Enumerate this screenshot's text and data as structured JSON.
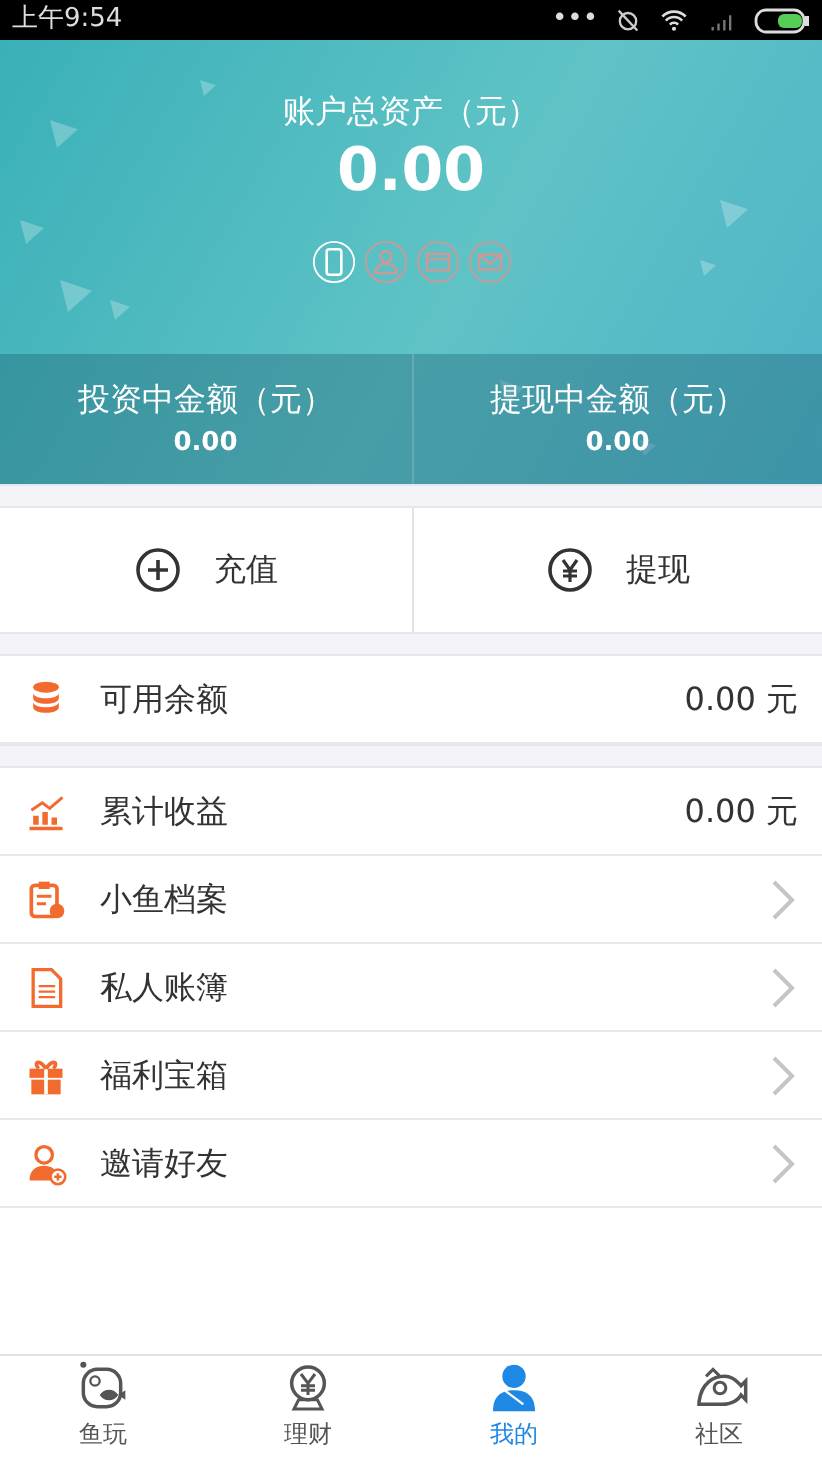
{
  "status_bar": {
    "time": "上午9:54",
    "dots": "•••"
  },
  "header": {
    "title": "账户总资产（元）",
    "total": "0.00",
    "verifications": [
      {
        "verified": true
      },
      {
        "verified": false
      },
      {
        "verified": false
      },
      {
        "verified": false
      }
    ],
    "stats": [
      {
        "label": "投资中金额（元）",
        "value": "0.00"
      },
      {
        "label": "提现中金额（元）",
        "value": "0.00"
      }
    ]
  },
  "actions": [
    {
      "label": "充值"
    },
    {
      "label": "提现"
    }
  ],
  "groups": [
    [
      {
        "kind": "value",
        "label": "可用余额",
        "value": "0.00 元"
      }
    ],
    [
      {
        "kind": "value",
        "label": "累计收益",
        "value": "0.00 元"
      },
      {
        "kind": "link",
        "label": "小鱼档案"
      },
      {
        "kind": "link",
        "label": "私人账簿"
      },
      {
        "kind": "link",
        "label": "福利宝箱"
      },
      {
        "kind": "link",
        "label": "邀请好友"
      }
    ]
  ],
  "tabs": [
    {
      "label": "鱼玩",
      "selected": false
    },
    {
      "label": "理财",
      "selected": false
    },
    {
      "label": "我的",
      "selected": true
    },
    {
      "label": "社区",
      "selected": false
    }
  ]
}
